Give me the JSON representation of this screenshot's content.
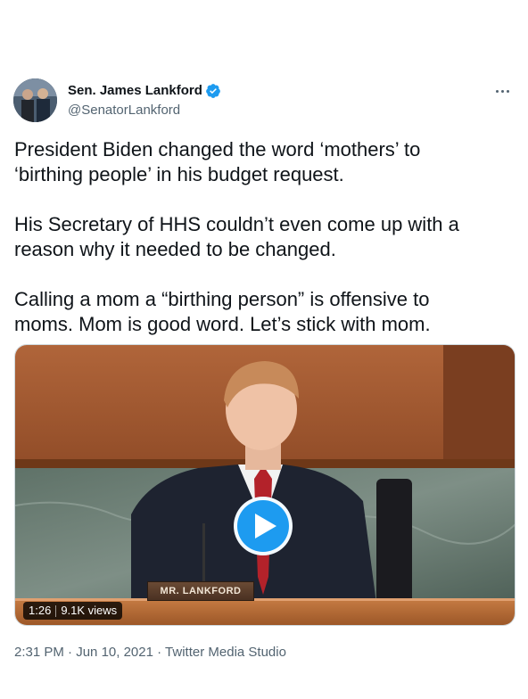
{
  "author": {
    "display_name": "Sen. James Lankford",
    "handle": "@SenatorLankford",
    "verified": true
  },
  "tweet": {
    "text": "President Biden changed the word ‘mothers’ to\n‘birthing people’ in his budget request.\n\nHis Secretary of HHS couldn’t even come up with a\nreason why it needed to be changed.\n\nCalling a mom a “birthing person” is offensive to\nmoms. Mom is good word. Let’s stick with mom."
  },
  "video": {
    "duration": "1:26",
    "views": "9.1K views",
    "nameplate": "MR. LANKFORD"
  },
  "footer": {
    "time": "2:31 PM",
    "date": "Jun 10, 2021",
    "source": "Twitter Media Studio",
    "separator": "·"
  },
  "colors": {
    "accent": "#1d9bf0",
    "secondary_text": "#536471"
  },
  "icons": [
    "verified-badge-icon",
    "more-options-icon",
    "play-icon"
  ]
}
